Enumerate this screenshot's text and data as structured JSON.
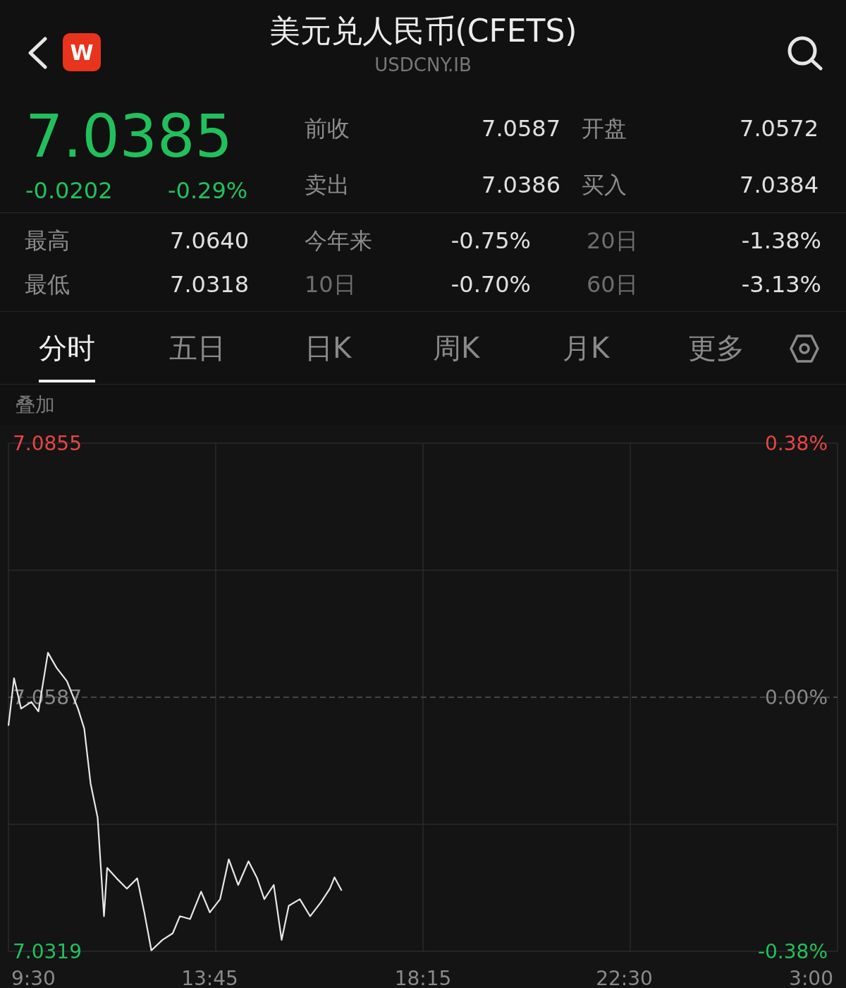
{
  "header": {
    "logo_text": "W",
    "title": "美元兑人民币(CFETS)",
    "subtitle": "USDCNY.IB"
  },
  "quote": {
    "price": "7.0385",
    "change": "-0.0202",
    "change_pct": "-0.29%"
  },
  "top_stats": [
    {
      "label": "前收",
      "value": "7.0587"
    },
    {
      "label": "开盘",
      "value": "7.0572"
    },
    {
      "label": "卖出",
      "value": "7.0386"
    },
    {
      "label": "买入",
      "value": "7.0384"
    }
  ],
  "stats": [
    {
      "label": "最高",
      "value": "7.0640"
    },
    {
      "label": "今年来",
      "value": "-0.75%"
    },
    {
      "label": "20日",
      "value": "-1.38%"
    },
    {
      "label": "最低",
      "value": "7.0318"
    },
    {
      "label": "10日",
      "value": "-0.70%"
    },
    {
      "label": "60日",
      "value": "-3.13%"
    }
  ],
  "tabs": [
    {
      "label": "分时",
      "selected": true
    },
    {
      "label": "五日",
      "selected": false
    },
    {
      "label": "日K",
      "selected": false
    },
    {
      "label": "周K",
      "selected": false
    },
    {
      "label": "月K",
      "selected": false
    },
    {
      "label": "更多",
      "selected": false
    }
  ],
  "overlay_label": "叠加",
  "chart": {
    "percent_labels": [
      {
        "label": "0.38%",
        "kind": "up"
      },
      {
        "label": "0.00%",
        "kind": "flat"
      },
      {
        "label": "-0.38%",
        "kind": "down"
      }
    ],
    "end_time_label": "3:00",
    "chart_data": {
      "type": "line",
      "x": [
        9.5,
        9.617,
        9.767,
        9.983,
        10.133,
        10.333,
        10.517,
        10.733,
        10.967,
        11.1,
        11.233,
        11.383,
        11.517,
        11.583,
        11.783,
        12,
        12.217,
        12.367,
        12.517,
        12.75,
        12.967,
        13.117,
        13.333,
        13.567,
        13.75,
        13.967,
        14.15,
        14.35,
        14.567,
        14.75,
        14.9,
        15.1,
        15.267,
        15.417,
        15.65,
        15.867,
        16.1,
        16.283,
        16.383,
        16.533
      ],
      "series": [
        {
          "color": "#e8e8e8",
          "values": [
            7.0557,
            7.0607,
            7.0575,
            7.0582,
            7.0572,
            7.0634,
            7.0618,
            7.0604,
            7.0575,
            7.0554,
            7.0496,
            7.046,
            7.0356,
            7.0407,
            7.0396,
            7.0385,
            7.0396,
            7.036,
            7.032,
            7.0331,
            7.0338,
            7.0356,
            7.0353,
            7.0382,
            7.036,
            7.0374,
            7.0416,
            7.0389,
            7.0414,
            7.0396,
            7.0374,
            7.0389,
            7.0331,
            7.0367,
            7.0374,
            7.0356,
            7.0371,
            7.0385,
            7.0397,
            7.0383
          ]
        }
      ],
      "xlim": [
        9.5,
        27
      ],
      "ylim": [
        7.0319,
        7.0855
      ],
      "xticks": [
        {
          "value": 9.5,
          "label": "9:30"
        },
        {
          "value": 13.75,
          "label": "13:45"
        },
        {
          "value": 18.25,
          "label": "18:15"
        },
        {
          "value": 22.5,
          "label": "22:30"
        }
      ],
      "yticks": [
        {
          "value": 7.0855,
          "label": "7.0855"
        },
        {
          "value": 7.0587,
          "label": "7.0587"
        },
        {
          "value": 7.0319,
          "label": "7.0319"
        }
      ],
      "ref_lines": [
        {
          "axis": "y",
          "value": 7.0587
        }
      ]
    }
  }
}
